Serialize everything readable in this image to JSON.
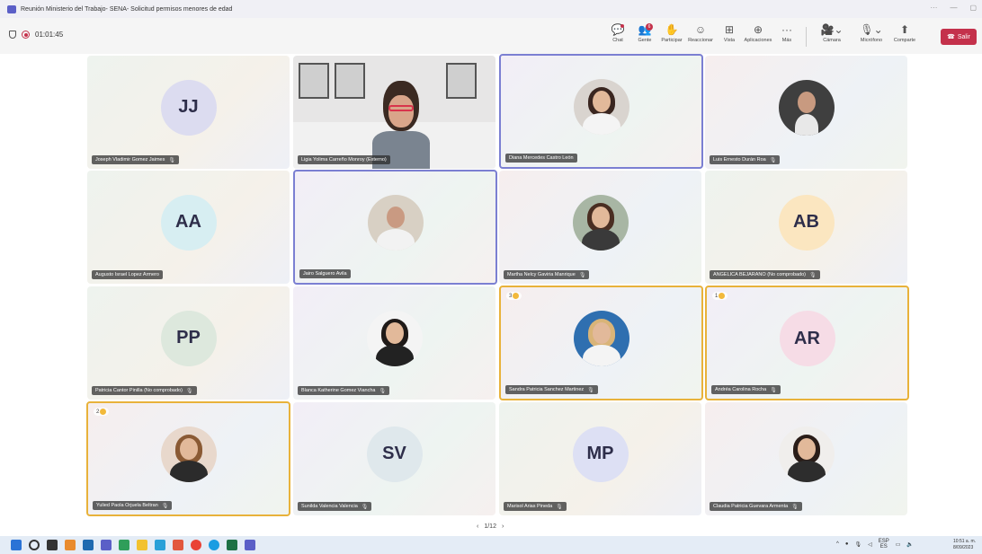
{
  "window": {
    "title": "Reunión Ministerio del Trabajo- SENA- Solicitud permisos menores de edad"
  },
  "meeting": {
    "elapsed": "01:01:45"
  },
  "toolbar": {
    "chat": "Chat",
    "people": "Gente",
    "people_badge": "6",
    "raise_hand": "Participar",
    "react": "Reaccionar",
    "view": "Vista",
    "apps": "Aplicaciones",
    "more": "Más",
    "camera": "Cámara",
    "mic": "Micrófono",
    "share": "Comparte",
    "leave": "Salir"
  },
  "tiles": [
    {
      "name": "Joseph Vladimir Gomez Jaimes",
      "initials": "JJ",
      "muted": true
    },
    {
      "name": "Ligia Yolima Carreño Monroy (Externo)",
      "muted": false
    },
    {
      "name": "Diana Mercedes Castro León",
      "muted": false
    },
    {
      "name": "Luis Ernesto Durán Roa",
      "muted": true
    },
    {
      "name": "Augusto Israel Lopez Armero",
      "initials": "AA",
      "muted": false
    },
    {
      "name": "Jairo Salguero Avila",
      "muted": false
    },
    {
      "name": "Martha Nelcy Gaviria Manrique",
      "muted": true
    },
    {
      "name": "ANGELICA BEJARANO (No comprobado)",
      "initials": "AB",
      "muted": true
    },
    {
      "name": "Patricia Cantor Pinilla (No comprobado)",
      "initials": "PP",
      "muted": true
    },
    {
      "name": "Blanca Katherine Gomez Viancha",
      "muted": true
    },
    {
      "name": "Sandra Patricia Sanchez Martinez",
      "muted": true,
      "hand": "3"
    },
    {
      "name": "Andréa Carolina Rocha",
      "initials": "AR",
      "muted": true,
      "hand": "1"
    },
    {
      "name": "Yulied Paola Orjuela Beltran",
      "muted": true,
      "hand": "2"
    },
    {
      "name": "Sunilda Valencia Valencia",
      "initials": "SV",
      "muted": true
    },
    {
      "name": "Marisol Arias Pineda",
      "initials": "MP",
      "muted": true
    },
    {
      "name": "Claudia Patricia Guevara Armenta",
      "muted": true
    }
  ],
  "pager": {
    "label": "1/12"
  },
  "tray": {
    "lang": "ESP",
    "lang2": "ES",
    "time": "10:51 a. m.",
    "date": "8/09/2023"
  },
  "colors": {
    "accent": "#5b5fc7",
    "leave": "#c4314b",
    "hand_highlight": "#e8b23a"
  }
}
